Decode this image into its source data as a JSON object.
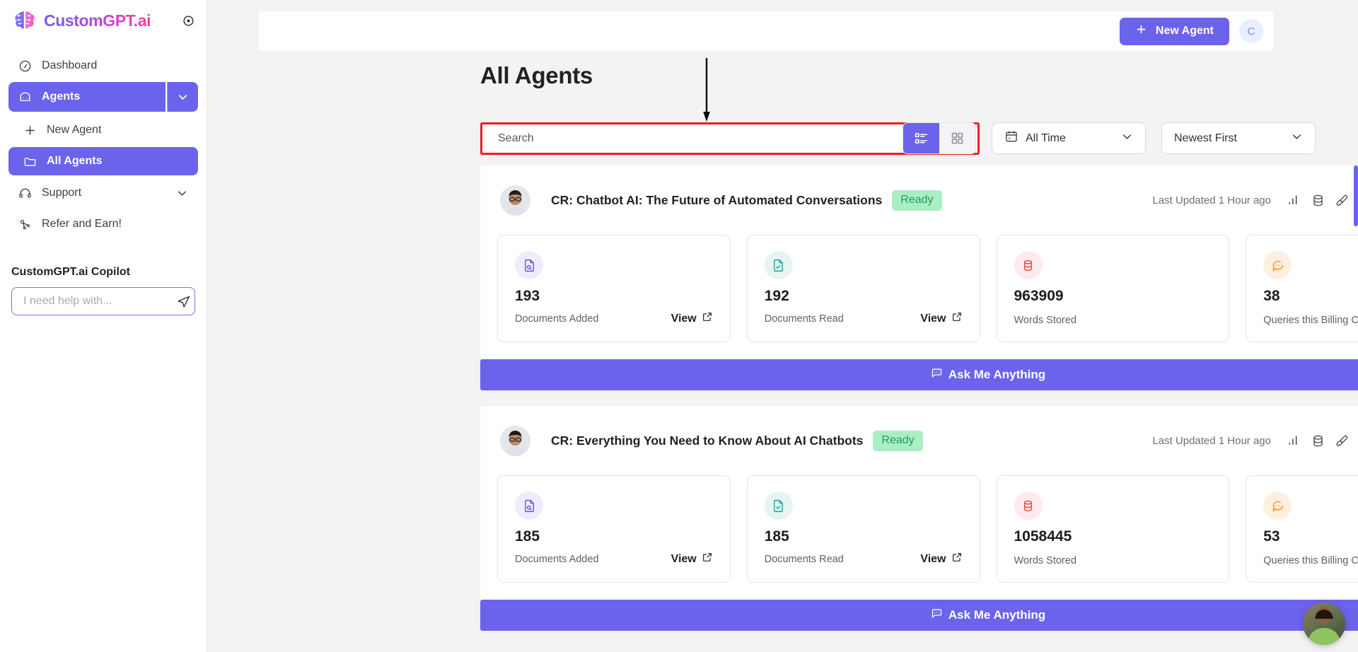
{
  "brand": {
    "name": "CustomGPT.ai",
    "logo_icon": "brain-icon",
    "collapse_icon": "circle-dot-icon"
  },
  "sidebar": {
    "items": [
      {
        "label": "Dashboard",
        "icon": "gauge-icon",
        "active": false
      },
      {
        "label": "Agents",
        "icon": "chat-bubble-icon",
        "active": true
      },
      {
        "label": "Support",
        "icon": "headset-icon",
        "active": false
      },
      {
        "label": "Refer and Earn!",
        "icon": "share-nodes-icon",
        "active": false
      }
    ],
    "sub_items": [
      {
        "label": "New Agent",
        "icon": "plus-icon",
        "active": false
      },
      {
        "label": "All Agents",
        "icon": "folder-icon",
        "active": true
      }
    ],
    "copilot": {
      "title": "CustomGPT.ai Copilot",
      "placeholder": "I need help with...",
      "value": "",
      "send_icon": "send-icon"
    }
  },
  "topbar": {
    "new_agent_label": "New Agent",
    "new_agent_icon": "plus-icon",
    "avatar_initial": "C"
  },
  "page": {
    "title": "All Agents",
    "search": {
      "placeholder": "Search",
      "value": "",
      "icon": "search-icon"
    },
    "view_toggle": {
      "list_icon": "list-view-icon",
      "grid_icon": "grid-view-icon",
      "active": "list"
    },
    "time_filter": {
      "label": "All Time",
      "icon": "calendar-icon",
      "caret": "chevron-down-icon"
    },
    "sort_filter": {
      "label": "Newest First",
      "caret": "chevron-down-icon"
    }
  },
  "colors": {
    "accent": "#6c63ed",
    "annotation": "#ec1c24",
    "status_bg": "#a9eec4",
    "status_text": "#1e9f57",
    "stat_doc_added": "#6c4fe8",
    "stat_doc_read": "#23a39b",
    "stat_words": "#ef4246",
    "stat_queries": "#f7952b"
  },
  "agent_action_icons": [
    "analytics-bar-chart-icon",
    "database-icon",
    "paintbrush-icon",
    "gear-icon",
    "rocket-icon",
    "copy-icon",
    "trash-icon",
    "archive-icon"
  ],
  "agents": [
    {
      "title": "CR: Chatbot AI: The Future of Automated Conversations",
      "status": "Ready",
      "updated": "Last Updated 1 Hour ago",
      "avatar": "user-avatar",
      "stats": [
        {
          "value": "193",
          "label": "Documents Added",
          "icon": "document-search-icon",
          "view_label": "View",
          "has_view": true
        },
        {
          "value": "192",
          "label": "Documents Read",
          "icon": "document-check-icon",
          "view_label": "View",
          "has_view": true
        },
        {
          "value": "963909",
          "label": "Words Stored",
          "icon": "database-icon",
          "has_view": false
        },
        {
          "value": "38",
          "label": "Queries this Billing Cycle",
          "icon": "chat-dots-icon",
          "has_view": false
        }
      ],
      "ama_label": "Ask Me Anything",
      "ama_icon": "chat-bubble-icon"
    },
    {
      "title": "CR: Everything You Need to Know About AI Chatbots",
      "status": "Ready",
      "updated": "Last Updated 1 Hour ago",
      "avatar": "user-avatar",
      "stats": [
        {
          "value": "185",
          "label": "Documents Added",
          "icon": "document-search-icon",
          "view_label": "View",
          "has_view": true
        },
        {
          "value": "185",
          "label": "Documents Read",
          "icon": "document-check-icon",
          "view_label": "View",
          "has_view": true
        },
        {
          "value": "1058445",
          "label": "Words Stored",
          "icon": "database-icon",
          "has_view": false
        },
        {
          "value": "53",
          "label": "Queries this Billing Cycle",
          "icon": "chat-dots-icon",
          "has_view": false
        }
      ],
      "ama_label": "Ask Me Anything",
      "ama_icon": "chat-bubble-icon"
    }
  ],
  "chat_widget": {
    "icon": "support-agent-avatar"
  }
}
